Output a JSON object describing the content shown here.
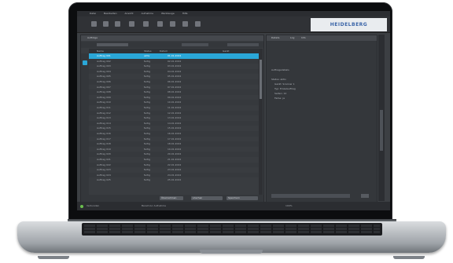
{
  "app": {
    "menu": [
      "Datei",
      "Bearbeiten",
      "Ansicht",
      "Aufnahme",
      "Werkzeuge",
      "Hilfe"
    ],
    "logo_text": "HEIDELBERG",
    "toolbar_icons": [
      "new-icon",
      "open-icon",
      "save-icon",
      "print-icon",
      "cut-icon",
      "copy-icon",
      "paste-icon",
      "undo-icon",
      "settings-icon"
    ]
  },
  "left_panel": {
    "title": "Aufträge",
    "columns": [
      "Name",
      "Status",
      "Datum",
      "Gerät"
    ],
    "rows": [
      {
        "name": "Auftrag 001",
        "status": "aktiv",
        "date": "01.01.2024"
      },
      {
        "name": "Auftrag 002",
        "status": "fertig",
        "date": "02.01.2024"
      },
      {
        "name": "Auftrag 003",
        "status": "fertig",
        "date": "03.01.2024"
      },
      {
        "name": "Auftrag 004",
        "status": "fertig",
        "date": "04.01.2024"
      },
      {
        "name": "Auftrag 005",
        "status": "fertig",
        "date": "05.01.2024"
      },
      {
        "name": "Auftrag 006",
        "status": "fertig",
        "date": "06.01.2024"
      },
      {
        "name": "Auftrag 007",
        "status": "fertig",
        "date": "07.01.2024"
      },
      {
        "name": "Auftrag 008",
        "status": "fertig",
        "date": "08.01.2024"
      },
      {
        "name": "Auftrag 009",
        "status": "fertig",
        "date": "09.01.2024"
      },
      {
        "name": "Auftrag 010",
        "status": "fertig",
        "date": "10.01.2024"
      },
      {
        "name": "Auftrag 011",
        "status": "fertig",
        "date": "11.01.2024"
      },
      {
        "name": "Auftrag 012",
        "status": "fertig",
        "date": "12.01.2024"
      },
      {
        "name": "Auftrag 013",
        "status": "fertig",
        "date": "13.01.2024"
      },
      {
        "name": "Auftrag 014",
        "status": "fertig",
        "date": "14.01.2024"
      },
      {
        "name": "Auftrag 015",
        "status": "fertig",
        "date": "15.01.2024"
      },
      {
        "name": "Auftrag 016",
        "status": "fertig",
        "date": "16.01.2024"
      },
      {
        "name": "Auftrag 017",
        "status": "fertig",
        "date": "17.01.2024"
      },
      {
        "name": "Auftrag 018",
        "status": "fertig",
        "date": "18.01.2024"
      },
      {
        "name": "Auftrag 019",
        "status": "fertig",
        "date": "19.01.2024"
      },
      {
        "name": "Auftrag 020",
        "status": "fertig",
        "date": "20.01.2024"
      },
      {
        "name": "Auftrag 021",
        "status": "fertig",
        "date": "21.01.2024"
      },
      {
        "name": "Auftrag 022",
        "status": "fertig",
        "date": "22.01.2024"
      },
      {
        "name": "Auftrag 023",
        "status": "fertig",
        "date": "23.01.2024"
      },
      {
        "name": "Auftrag 024",
        "status": "fertig",
        "date": "24.01.2024"
      },
      {
        "name": "Auftrag 025",
        "status": "fertig",
        "date": "25.01.2024"
      }
    ],
    "buttons": [
      "Übernehmen",
      "Löschen",
      "Speichern"
    ]
  },
  "right_panel": {
    "tabs": [
      "Details",
      "Log",
      "Info"
    ],
    "lines": [
      "Auftragsdetails",
      "",
      "Status: aktiv",
      "Gerät: Scanner 1",
      "Typ: Einzelauftrag",
      "Seiten: 12",
      "Farbe: ja"
    ],
    "field_value": ""
  },
  "status": {
    "left": "Verbunden",
    "middle": "Bereit zur Aufnahme",
    "right": "100%"
  },
  "colors": {
    "accent": "#2aa7d8",
    "screen_bg": "#3c3f43",
    "status_ok": "#6bbf4e"
  }
}
